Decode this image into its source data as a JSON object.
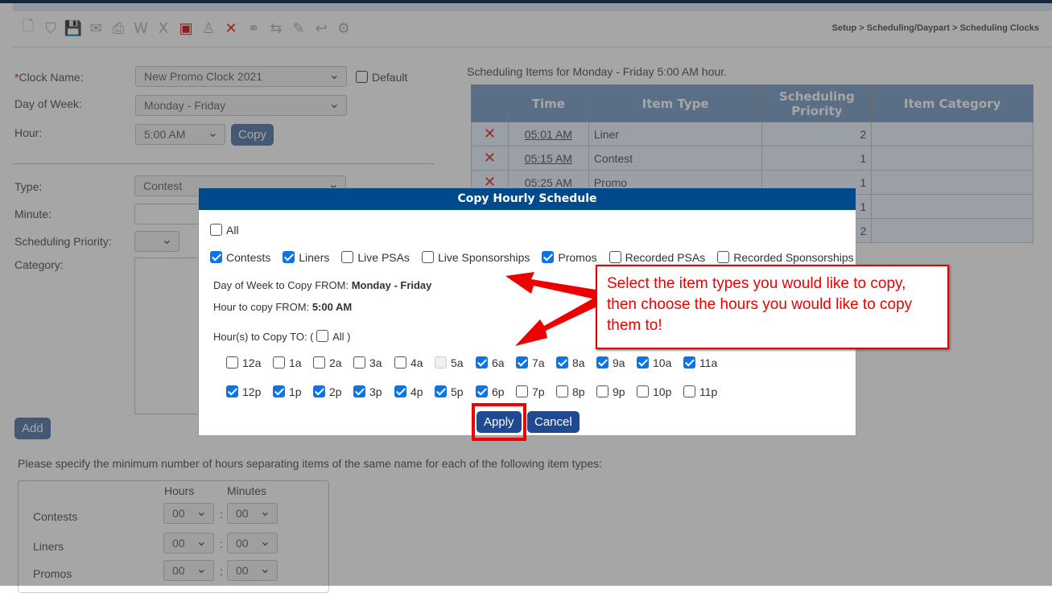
{
  "toolbar": {
    "icons": [
      "new-document-icon",
      "shield-icon",
      "save-icon",
      "email-icon",
      "print-icon",
      "word-icon",
      "excel-icon",
      "pdf-icon",
      "user-icon",
      "delete-icon",
      "link-icon",
      "transfer-icon",
      "edit-icon",
      "undo-icon",
      "settings-icon"
    ],
    "breadcrumb": "Setup > Scheduling/Daypart > Scheduling Clocks"
  },
  "form": {
    "clock_name_label": "Clock Name:",
    "required_mark": "*",
    "clock_name": "New Promo Clock 2021",
    "default_label": "Default",
    "day_label": "Day of Week:",
    "day": "Monday - Friday",
    "hour_label": "Hour:",
    "hour": "5:00 AM",
    "copy": "Copy",
    "type_label": "Type:",
    "type": "Contest",
    "minute_label": "Minute:",
    "priority_label": "Scheduling Priority:",
    "category_label": "Category:",
    "add": "Add"
  },
  "separation": {
    "intro": "Please specify the minimum number of hours separating items of the same name for each of the following item types:",
    "hours_label": "Hours",
    "minutes_label": "Minutes",
    "rows": [
      {
        "name": "Contests",
        "hours": "00",
        "minutes": "00"
      },
      {
        "name": "Liners",
        "hours": "00",
        "minutes": "00"
      },
      {
        "name": "Promos",
        "hours": "00",
        "minutes": "00"
      }
    ]
  },
  "schedule": {
    "title": "Scheduling Items for Monday - Friday 5:00 AM hour.",
    "headers": [
      "",
      "Time",
      "Item Type",
      "Scheduling Priority",
      "Item Category"
    ],
    "rows": [
      {
        "time": "05:01 AM",
        "type": "Liner",
        "priority": "2",
        "category": ""
      },
      {
        "time": "05:15 AM",
        "type": "Contest",
        "priority": "1",
        "category": ""
      },
      {
        "time": "05:25 AM",
        "type": "Promo",
        "priority": "1",
        "category": ""
      },
      {
        "time": "",
        "type": "",
        "priority": "1",
        "category": ""
      },
      {
        "time": "",
        "type": "",
        "priority": "2",
        "category": ""
      }
    ]
  },
  "dialog": {
    "title": "Copy Hourly Schedule",
    "all_label": "All",
    "all_checked": false,
    "types": [
      {
        "label": "Contests",
        "checked": true
      },
      {
        "label": "Liners",
        "checked": true
      },
      {
        "label": "Live PSAs",
        "checked": false
      },
      {
        "label": "Live Sponsorships",
        "checked": false
      },
      {
        "label": "Promos",
        "checked": true
      },
      {
        "label": "Recorded PSAs",
        "checked": false
      },
      {
        "label": "Recorded Sponsorships",
        "checked": false
      }
    ],
    "from_day_label": "Day of Week to Copy FROM:",
    "from_day": "Monday - Friday",
    "from_hour_label": "Hour to copy FROM:",
    "from_hour": "5:00 AM",
    "to_label": "Hour(s) to Copy TO: (",
    "to_all": "All )",
    "hours": [
      {
        "label": "12a",
        "state": "off"
      },
      {
        "label": "1a",
        "state": "off"
      },
      {
        "label": "2a",
        "state": "off"
      },
      {
        "label": "3a",
        "state": "off"
      },
      {
        "label": "4a",
        "state": "off"
      },
      {
        "label": "5a",
        "state": "disabled"
      },
      {
        "label": "6a",
        "state": "on"
      },
      {
        "label": "7a",
        "state": "on"
      },
      {
        "label": "8a",
        "state": "on"
      },
      {
        "label": "9a",
        "state": "on"
      },
      {
        "label": "10a",
        "state": "on"
      },
      {
        "label": "11a",
        "state": "on"
      },
      {
        "label": "12p",
        "state": "on"
      },
      {
        "label": "1p",
        "state": "on"
      },
      {
        "label": "2p",
        "state": "on"
      },
      {
        "label": "3p",
        "state": "on"
      },
      {
        "label": "4p",
        "state": "on"
      },
      {
        "label": "5p",
        "state": "on"
      },
      {
        "label": "6p",
        "state": "on"
      },
      {
        "label": "7p",
        "state": "off"
      },
      {
        "label": "8p",
        "state": "off"
      },
      {
        "label": "9p",
        "state": "off"
      },
      {
        "label": "10p",
        "state": "off"
      },
      {
        "label": "11p",
        "state": "off"
      }
    ],
    "apply": "Apply",
    "cancel": "Cancel"
  },
  "annotation": {
    "text": "Select the item types you would like to copy, then choose the hours you would like to copy them to!",
    "color": "#ee0000"
  }
}
